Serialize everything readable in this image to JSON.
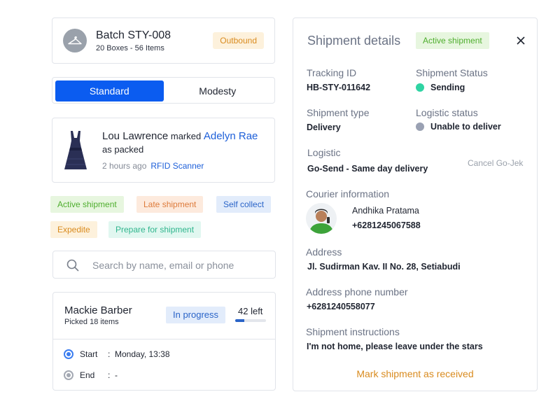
{
  "batch": {
    "title": "Batch STY-008",
    "subtitle": "20 Boxes - 56 Items",
    "badge": "Outbound",
    "icon": "hanger-icon"
  },
  "segmented": {
    "options": [
      "Standard",
      "Modesty"
    ],
    "selected": "Standard"
  },
  "activity": {
    "actor": "Lou Lawrence",
    "verb": "marked",
    "target": "Adelyn Rae",
    "action": "as packed",
    "time": "2 hours ago",
    "source": "RFID Scanner"
  },
  "tags": [
    "Active shipment",
    "Late shipment",
    "Self collect",
    "Expedite",
    "Prepare for shipment"
  ],
  "search": {
    "placeholder": "Search by name, email or phone",
    "value": ""
  },
  "picker": {
    "name": "Mackie Barber",
    "subtitle": "Picked 18 items",
    "status": "In progress",
    "left_label": "42 left",
    "progress_fraction": 0.3,
    "start_label": "Start",
    "start_value": "Monday, 13:38",
    "end_label": "End",
    "end_value": "-",
    "separator": ":"
  },
  "details": {
    "title": "Shipment details",
    "badge": "Active shipment",
    "tracking_label": "Tracking ID",
    "tracking_value": "HB-STY-011642",
    "status_label": "Shipment Status",
    "status_value": "Sending",
    "status_color": "#2fd4a3",
    "type_label": "Shipment type",
    "type_value": "Delivery",
    "logistic_status_label": "Logistic status",
    "logistic_status_value": "Unable to deliver",
    "logistic_status_color": "#9aa1b3",
    "logistic_label": "Logistic",
    "logistic_value": "Go-Send - Same day delivery",
    "cancel_label": "Cancel Go-Jek",
    "courier_label": "Courier information",
    "courier_name": "Andhika Pratama",
    "courier_phone": "+6281245067588",
    "address_label": "Address",
    "address_value": "Jl. Sudirman Kav. II No. 28, Setiabudi",
    "address_phone_label": "Address phone number",
    "address_phone_value": "+6281240558077",
    "instructions_label": "Shipment instructions",
    "instructions_value": "I'm not home, please leave under the stars",
    "mark_received": "Mark shipment as received"
  }
}
